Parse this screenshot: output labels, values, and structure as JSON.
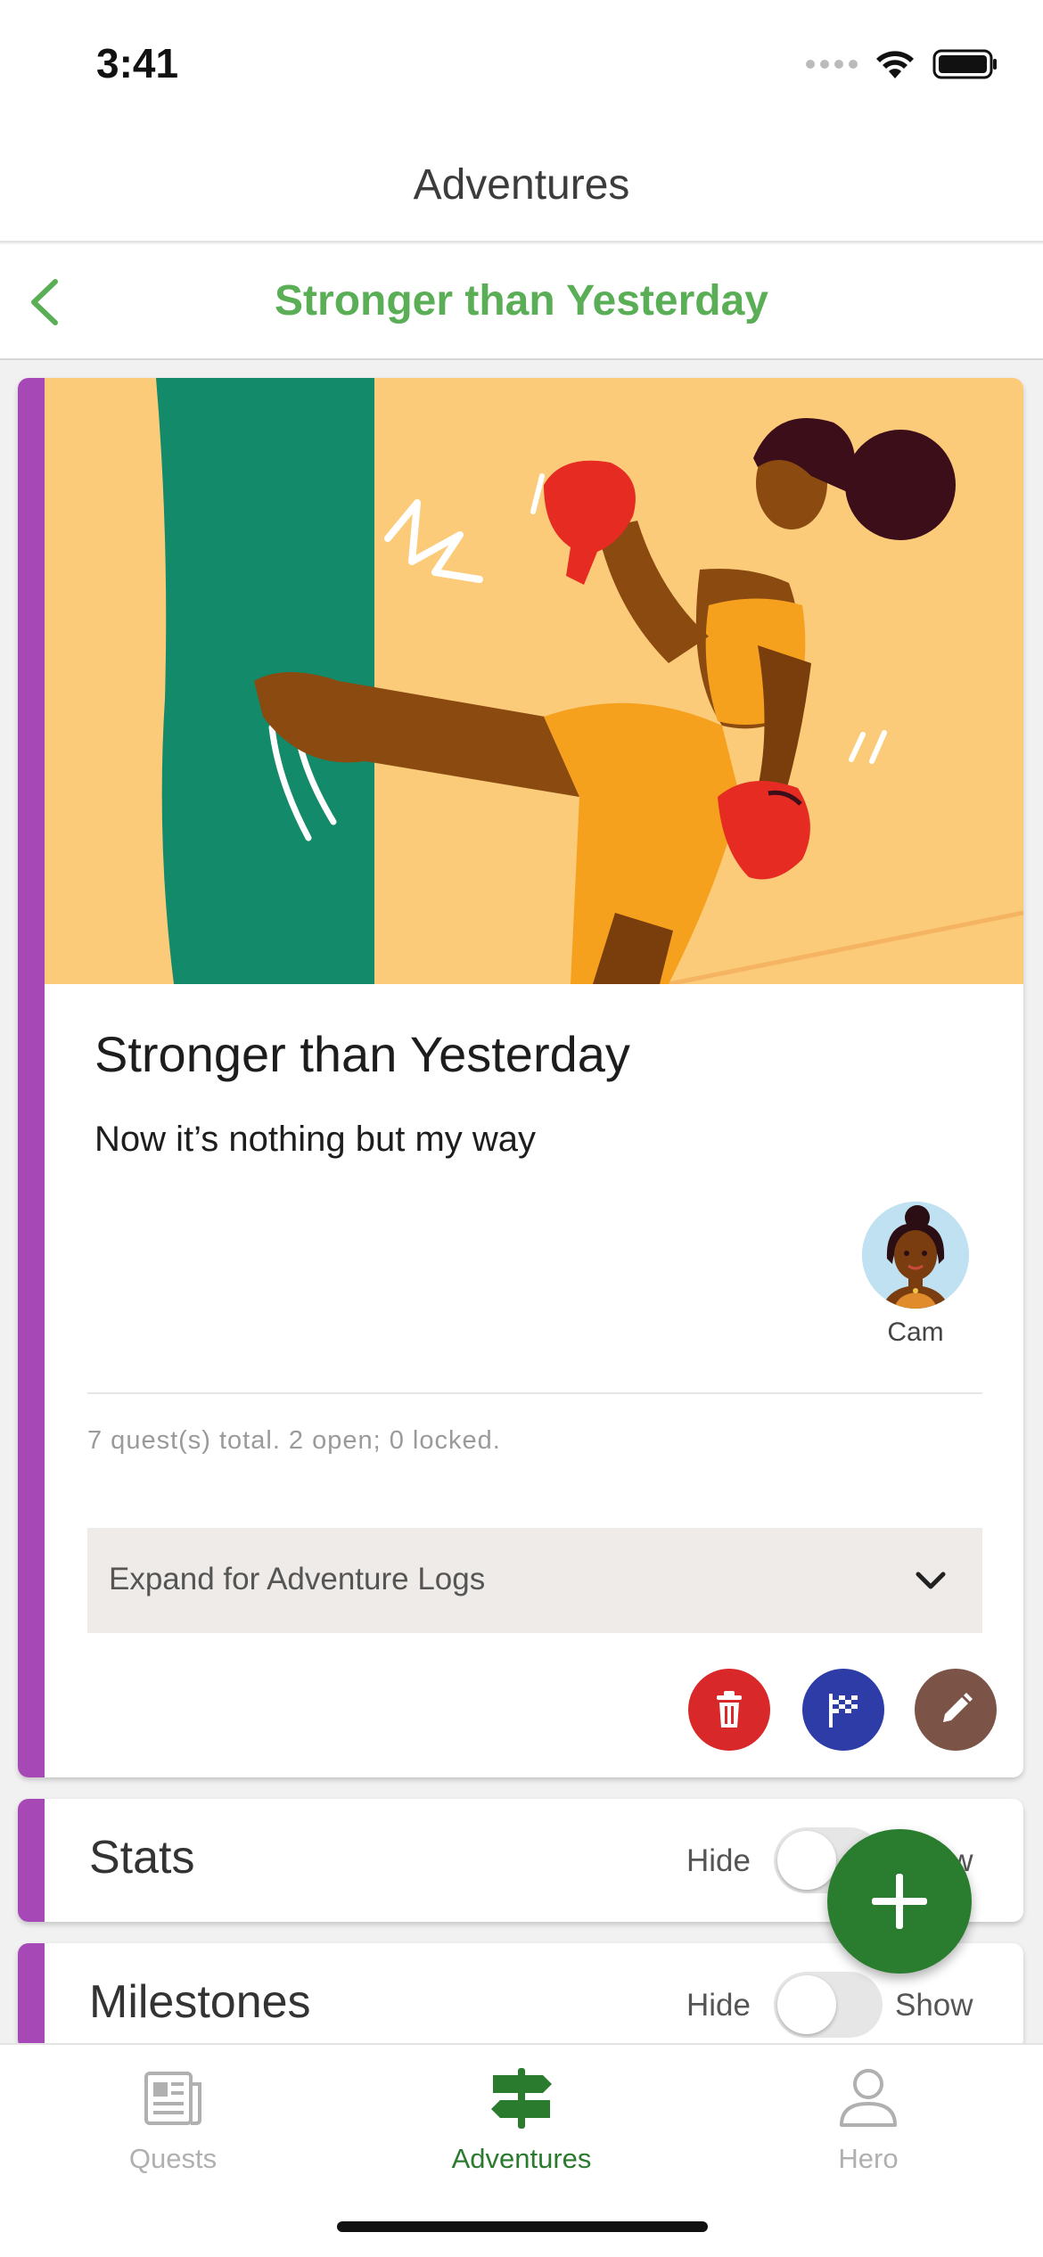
{
  "status_bar": {
    "time": "3:41"
  },
  "app_header": {
    "title": "Adventures"
  },
  "nav": {
    "title": "Stronger than Yesterday",
    "back_icon": "chevron-left-icon"
  },
  "adventure": {
    "title": "Stronger than Yesterday",
    "subtitle": "Now it’s nothing but my way",
    "member_name": "Cam",
    "quest_summary": "7 quest(s) total. 2 open; 0 locked.",
    "expand_label": "Expand for Adventure Logs",
    "actions": {
      "delete_icon": "trash-icon",
      "finish_icon": "checkered-flag-icon",
      "edit_icon": "pencil-icon"
    }
  },
  "sections": {
    "stats": {
      "title": "Stats",
      "hide_label": "Hide",
      "show_label": "Show"
    },
    "milestones": {
      "title": "Milestones",
      "hide_label": "Hide",
      "show_label": "Show"
    }
  },
  "tabs": [
    {
      "label": "Quests",
      "icon": "newspaper-icon"
    },
    {
      "label": "Adventures",
      "icon": "signpost-icon"
    },
    {
      "label": "Hero",
      "icon": "person-icon"
    }
  ],
  "colors": {
    "accent_green": "#5aae55",
    "card_accent": "#a748b7",
    "fab_green": "#2a7d2e",
    "delete_red": "#d9282a",
    "finish_blue": "#2e3ca8",
    "edit_brown": "#7b5347"
  }
}
